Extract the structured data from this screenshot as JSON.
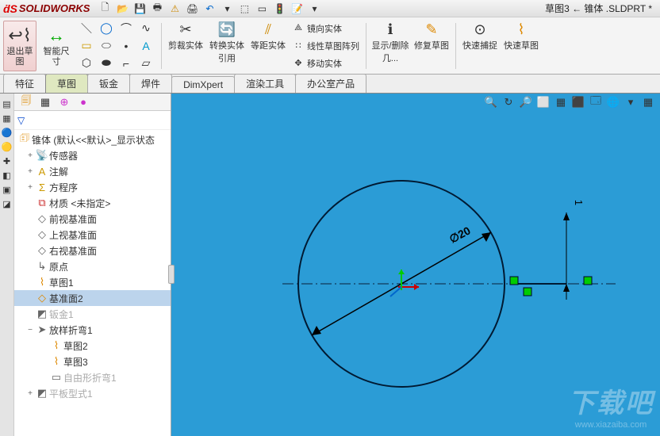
{
  "title": {
    "logo": "SOLIDWORKS",
    "document": "草图3 ← 锥体 .SLDPRT *"
  },
  "qat": [
    "new",
    "open",
    "save",
    "print",
    "warn",
    "print2",
    "undo",
    "redo",
    "select",
    "rect",
    "light",
    "note",
    "opts"
  ],
  "ribbon": {
    "exit": "退出草图",
    "smart_dim": "智能尺寸",
    "trim": "剪裁实体",
    "convert": "转换实体引用",
    "offset": "等距实体",
    "rows": {
      "mirror": "镜向实体",
      "pattern": "线性草图阵列",
      "move": "移动实体"
    },
    "display": "显示/删除几...",
    "repair": "修复草图",
    "snap": "快速捕捉",
    "quick": "快速草图"
  },
  "tabs": [
    "特征",
    "草图",
    "钣金",
    "焊件",
    "DimXpert",
    "渲染工具",
    "办公室产品"
  ],
  "active_tab": 1,
  "tree": {
    "root": "锥体   (默认<<默认>_显示状态",
    "items": [
      {
        "icon": "📡",
        "label": "传感器",
        "exp": "+"
      },
      {
        "icon": "A",
        "label": "注解",
        "exp": "+",
        "color": "#c90"
      },
      {
        "icon": "Σ",
        "label": "方程序",
        "exp": "+",
        "color": "#c90"
      },
      {
        "icon": "⧉",
        "label": "材质 <未指定>",
        "color": "#c33"
      },
      {
        "icon": "◇",
        "label": "前视基准面"
      },
      {
        "icon": "◇",
        "label": "上视基准面"
      },
      {
        "icon": "◇",
        "label": "右视基准面"
      },
      {
        "icon": "↳",
        "label": "原点"
      },
      {
        "icon": "⌇",
        "label": "草图1",
        "color": "#d80"
      },
      {
        "icon": "◇",
        "label": "基准面2",
        "sel": true,
        "color": "#d80"
      },
      {
        "icon": "◩",
        "label": "钣金1",
        "gray": true
      },
      {
        "icon": "➤",
        "label": "放样折弯1",
        "exp": "−"
      },
      {
        "icon": "⌇",
        "label": "草图2",
        "lvl": 2,
        "color": "#d80"
      },
      {
        "icon": "⌇",
        "label": "草图3",
        "lvl": 2,
        "color": "#d80"
      },
      {
        "icon": "▭",
        "label": "自由形折弯1",
        "lvl": 2,
        "gray": true
      },
      {
        "icon": "◩",
        "label": "平板型式1",
        "exp": "+",
        "gray": true
      }
    ]
  },
  "view_icons": [
    "🔍",
    "↻",
    "🔎",
    "⬜",
    "▦",
    "⬛",
    "🗔",
    "🌐",
    "▾",
    "▦"
  ],
  "dimension": {
    "dia": "∅20",
    "one": "1"
  },
  "watermark": {
    "big": "下载吧",
    "url": "www.xiazaiba.com"
  }
}
